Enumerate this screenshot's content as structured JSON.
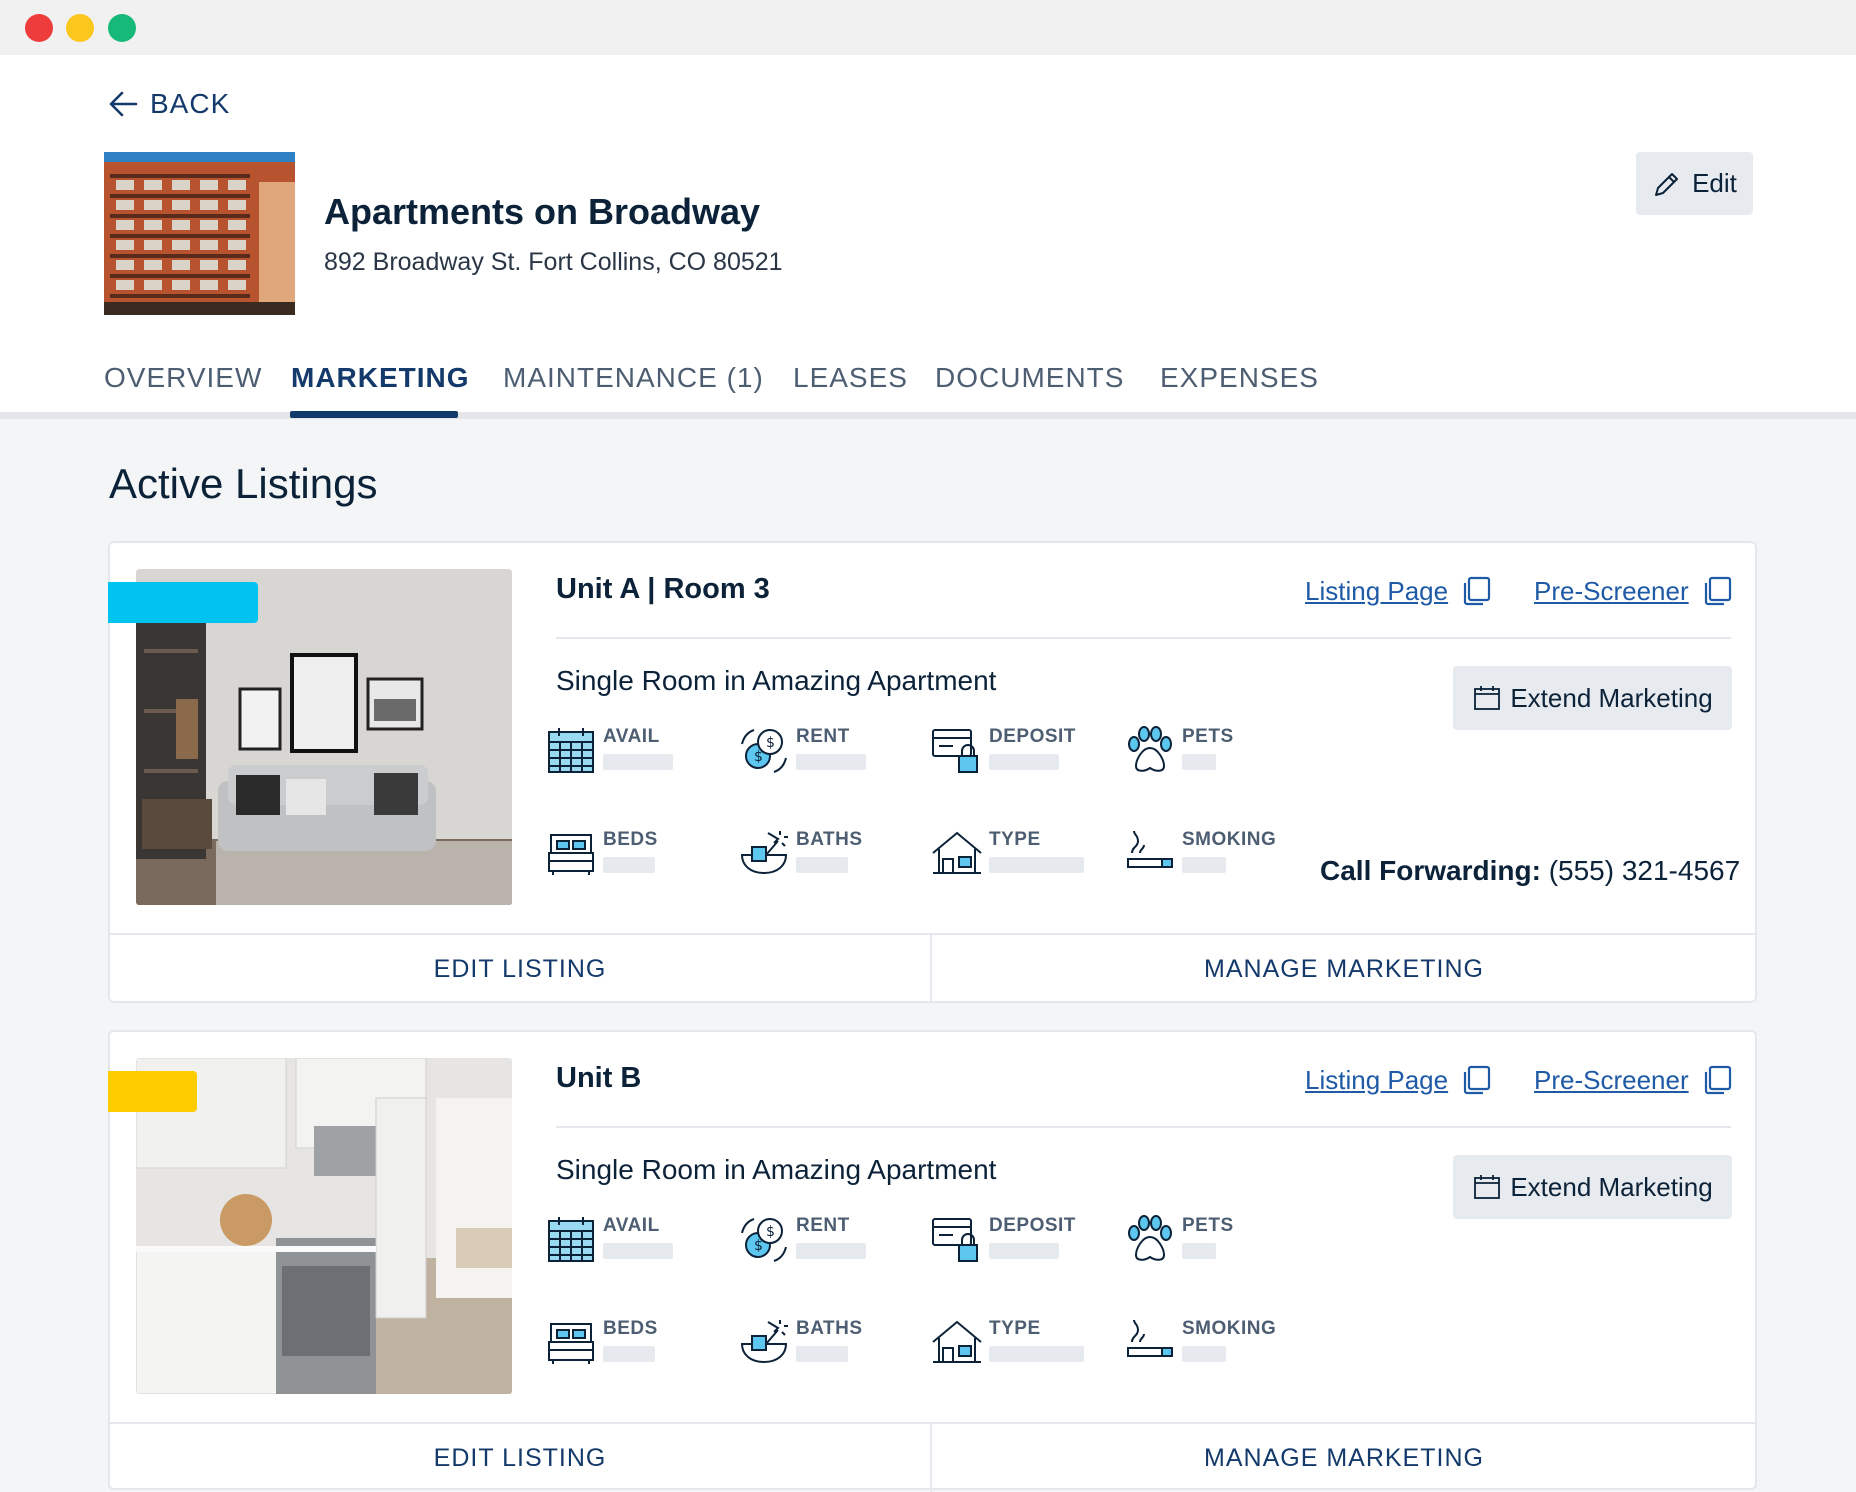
{
  "nav": {
    "back_label": "BACK"
  },
  "property": {
    "name": "Apartments on Broadway",
    "address": "892 Broadway St. Fort Collins, CO 80521",
    "edit_label": "Edit"
  },
  "tabs": [
    {
      "label": "OVERVIEW",
      "active": false
    },
    {
      "label": "MARKETING",
      "active": true
    },
    {
      "label": "MAINTENANCE (1)",
      "active": false
    },
    {
      "label": "LEASES",
      "active": false
    },
    {
      "label": "DOCUMENTS",
      "active": false
    },
    {
      "label": "EXPENSES",
      "active": false
    }
  ],
  "section_title": "Active Listings",
  "colors": {
    "brand": "#143a6b",
    "link": "#1f5aa6",
    "status_active": "#00c3ef",
    "status_pending": "#ffcc00"
  },
  "listings": [
    {
      "unit": "Unit A | Room 3",
      "listing_page_label": "Listing Page",
      "prescreener_label": "Pre-Screener",
      "title": "Single Room in Amazing Apartment",
      "extend_label": "Extend Marketing",
      "features": {
        "avail": "AVAIL",
        "rent": "RENT",
        "deposit": "DEPOSIT",
        "pets": "PETS",
        "beds": "BEDS",
        "baths": "BATHS",
        "type": "TYPE",
        "smoking": "SMOKING"
      },
      "call_label": "Call Forwarding:",
      "call_number": "(555) 321-4567",
      "edit_listing_label": "EDIT LISTING",
      "manage_marketing_label": "MANAGE MARKETING"
    },
    {
      "unit": "Unit B",
      "listing_page_label": "Listing Page",
      "prescreener_label": "Pre-Screener",
      "title": "Single Room in Amazing Apartment",
      "extend_label": "Extend Marketing",
      "features": {
        "avail": "AVAIL",
        "rent": "RENT",
        "deposit": "DEPOSIT",
        "pets": "PETS",
        "beds": "BEDS",
        "baths": "BATHS",
        "type": "TYPE",
        "smoking": "SMOKING"
      },
      "edit_listing_label": "EDIT LISTING",
      "manage_marketing_label": "MANAGE MARKETING"
    }
  ]
}
